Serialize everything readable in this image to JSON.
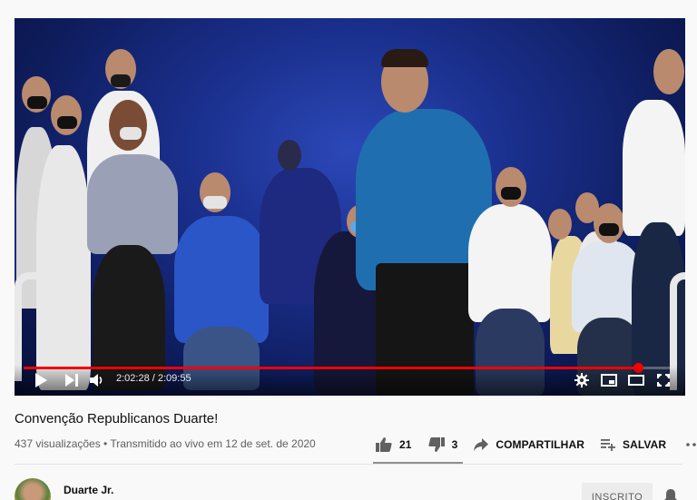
{
  "video": {
    "current_time": "2:02:28",
    "separator": " / ",
    "duration": "2:09:55",
    "progress_fraction": 0.942
  },
  "title": "Convenção Republicanos Duarte!",
  "meta": "437 visualizações • Transmitido ao vivo em 12 de set. de 2020",
  "actions": {
    "likes": "21",
    "dislikes": "3",
    "share": "COMPARTILHAR",
    "save": "SALVAR"
  },
  "channel": {
    "name": "Duarte Jr.",
    "subscribe_label": "INSCRITO"
  },
  "colors": {
    "progress": "#ff0000",
    "stage_blue": "#1a2f8c"
  },
  "icons": [
    "play-icon",
    "next-icon",
    "volume-icon",
    "settings-icon",
    "miniplayer-icon",
    "theater-icon",
    "fullscreen-icon",
    "thumbs-up-icon",
    "thumbs-down-icon",
    "share-icon",
    "add-to-playlist-icon",
    "more-icon",
    "bell-icon"
  ]
}
